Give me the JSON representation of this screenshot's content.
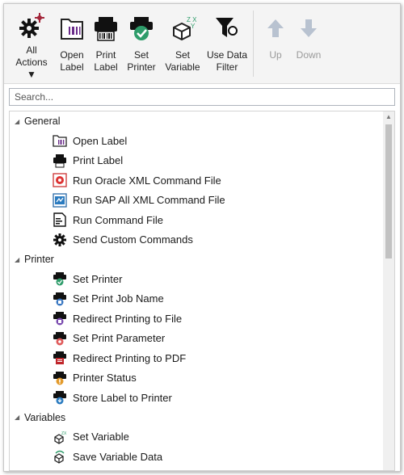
{
  "toolbar": {
    "buttons": [
      {
        "label": "All\nActions ▼",
        "icon": "gear-sparkle-icon"
      },
      {
        "label": "Open\nLabel",
        "icon": "open-label-icon"
      },
      {
        "label": "Print\nLabel",
        "icon": "printer-icon"
      },
      {
        "label": "Set\nPrinter",
        "icon": "set-printer-icon"
      },
      {
        "label": "Set\nVariable",
        "icon": "set-variable-icon"
      },
      {
        "label": "Use Data\nFilter",
        "icon": "filter-icon"
      },
      {
        "label": "Up",
        "icon": "arrow-up-icon"
      },
      {
        "label": "Down",
        "icon": "arrow-down-icon"
      }
    ]
  },
  "search": {
    "placeholder": "Search..."
  },
  "groups": [
    {
      "label": "General",
      "items": [
        "Open Label",
        "Print Label",
        "Run Oracle XML Command File",
        "Run SAP All XML Command File",
        "Run Command File",
        "Send Custom Commands"
      ]
    },
    {
      "label": "Printer",
      "items": [
        "Set Printer",
        "Set Print Job Name",
        "Redirect Printing to File",
        "Set Print Parameter",
        "Redirect Printing to PDF",
        "Printer Status",
        "Store Label to Printer"
      ]
    },
    {
      "label": "Variables",
      "items": [
        "Set Variable",
        "Save Variable Data"
      ]
    }
  ],
  "colors": {
    "accent_purple": "#6a2c8a",
    "printer_green": "#2e9c6a",
    "disabled_arrow": "#b8c2d0"
  }
}
